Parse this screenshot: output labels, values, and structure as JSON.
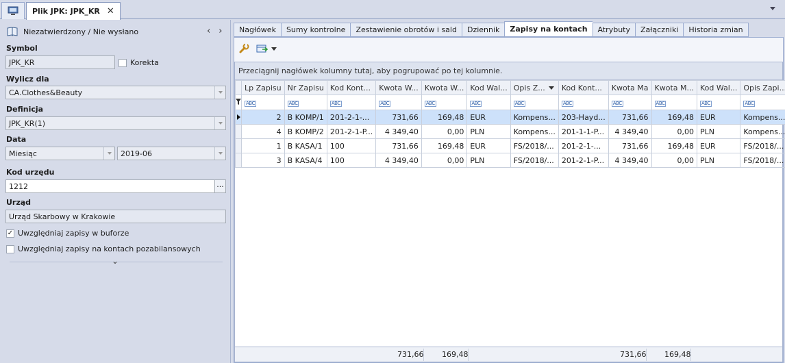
{
  "window": {
    "tab_title": "Plik JPK: JPK_KR",
    "close_glyph": "✕"
  },
  "left_panel": {
    "status": "Niezatwierdzony / Nie wysłano",
    "nav_prev": "‹",
    "nav_next": "›",
    "symbol_label": "Symbol",
    "symbol_value": "JPK_KR",
    "korekta_label": "Korekta",
    "korekta_checked": false,
    "wylicz_label": "Wylicz dla",
    "wylicz_value": "CA.Clothes&Beauty",
    "definicja_label": "Definicja",
    "definicja_value": "JPK_KR(1)",
    "data_label": "Data",
    "data_period": "Miesiąc",
    "data_value": "2019-06",
    "kod_urzedu_label": "Kod urzędu",
    "kod_urzedu_value": "1212",
    "kod_urzedu_button": "···",
    "urzad_label": "Urząd",
    "urzad_value": "Urząd Skarbowy w Krakowie",
    "opt_bufor_label": "Uwzględniaj zapisy w buforze",
    "opt_bufor_checked": true,
    "opt_pozabil_label": "Uwzględniaj zapisy na kontach pozabilansowych",
    "opt_pozabil_checked": false,
    "collapse_glyph": "⌄"
  },
  "tabs": [
    {
      "label": "Nagłówek",
      "active": false
    },
    {
      "label": "Sumy kontrolne",
      "active": false
    },
    {
      "label": "Zestawienie obrotów i sald",
      "active": false
    },
    {
      "label": "Dziennik",
      "active": false
    },
    {
      "label": "Zapisy na kontach",
      "active": true
    },
    {
      "label": "Atrybuty",
      "active": false
    },
    {
      "label": "Załączniki",
      "active": false
    },
    {
      "label": "Historia zmian",
      "active": false
    }
  ],
  "grid": {
    "group_hint": "Przeciągnij nagłówek kolumny tutaj, aby pogrupować po tej kolumnie.",
    "filter_placeholder": "ABC",
    "columns": [
      "Lp Zapisu",
      "Nr Zapisu",
      "Kod Kont...",
      "Kwota W...",
      "Kwota W...",
      "Kod Wal...",
      "Opis Z...",
      "Kod Kont...",
      "Kwota Ma",
      "Kwota M...",
      "Kod Wal...",
      "Opis Zapi..."
    ],
    "sorted_column_index": 6,
    "rows": [
      [
        "2",
        "B KOMP/1",
        "201-2-1-...",
        "731,66",
        "169,48",
        "EUR",
        "Kompens...",
        "203-Hayd...",
        "731,66",
        "169,48",
        "EUR",
        "Kompens..."
      ],
      [
        "4",
        "B KOMP/2",
        "201-2-1-P...",
        "4 349,40",
        "0,00",
        "PLN",
        "Kompens...",
        "201-1-1-P...",
        "4 349,40",
        "0,00",
        "PLN",
        "Kompens..."
      ],
      [
        "1",
        "B KASA/1",
        "100",
        "731,66",
        "169,48",
        "EUR",
        "FS/2018/...",
        "201-2-1-...",
        "731,66",
        "169,48",
        "EUR",
        "FS/2018/..."
      ],
      [
        "3",
        "B KASA/4",
        "100",
        "4 349,40",
        "0,00",
        "PLN",
        "FS/2018/...",
        "201-2-1-P...",
        "4 349,40",
        "0,00",
        "PLN",
        "FS/2018/..."
      ]
    ],
    "selected_row": 0,
    "totals": {
      "kwota_wn": "731,66",
      "kwota_wn_waluta": "169,48",
      "kwota_ma": "731,66",
      "kwota_ma_waluta": "169,48"
    }
  },
  "icons": {
    "home": "monitor-icon",
    "book": "book-icon",
    "wrench": "wrench-icon",
    "export": "export-grid-icon"
  },
  "colors": {
    "accent": "#3060a8",
    "selection": "#cde1fa",
    "background": "#d6dbe9"
  }
}
